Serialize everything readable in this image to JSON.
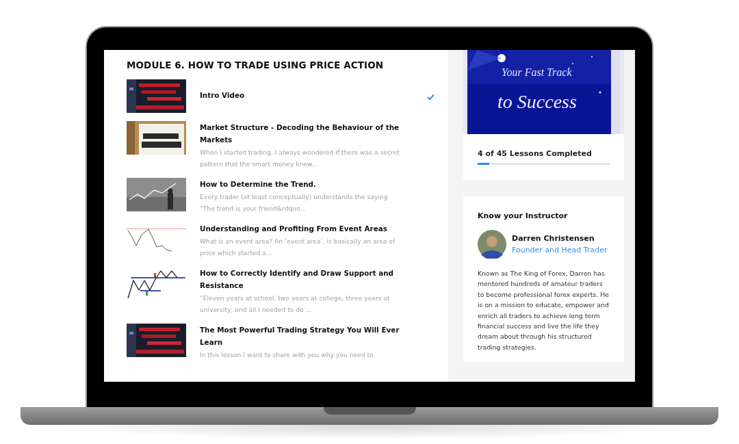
{
  "module": {
    "title": "MODULE 6. HOW TO TRADE USING PRICE ACTION"
  },
  "lessons": [
    {
      "title": "Intro Video",
      "completed": true
    },
    {
      "title": "Market Structure - Decoding the Behaviour of the Markets",
      "excerpt": "When I started trading, I always wondered if there was a secret pattern that the smart money knew...",
      "completed": false
    },
    {
      "title": "How to Determine the Trend.",
      "excerpt": "Every trader (at least conceptually) understands the saying “The trend is your friend&rdquo...",
      "completed": false
    },
    {
      "title": "Understanding and Profiting From Event Areas",
      "excerpt": "What is an event area? An ‘event area’, is basically an area of price which started a...",
      "completed": false
    },
    {
      "title": "How to Correctly Identify and Draw Support and Resistance",
      "excerpt": "“Eleven years at school, two years at college, three years at university, and all I needed to do ...",
      "completed": false
    },
    {
      "title": "The Most Powerful Trading Strategy You Will Ever Learn",
      "excerpt": "In this lesson I want to share with you why you need to",
      "completed": false
    }
  ],
  "banner": {
    "line_1": "Your Fast Track",
    "line_2": "to Success"
  },
  "progress": {
    "label": "4 of 45 Lessons Completed",
    "level": 0.09
  },
  "instructor": {
    "heading": "Know your Instructor",
    "name": "Darren Christensen",
    "role": "Founder and Head Trader",
    "bio": "Known as The King of Forex, Darren has mentored hundreds of amateur traders to become professional forex experts. He is on a mission to educate, empower and enrich all traders to achieve long term financial success and live the life they dream about through his structured trading strategies."
  }
}
